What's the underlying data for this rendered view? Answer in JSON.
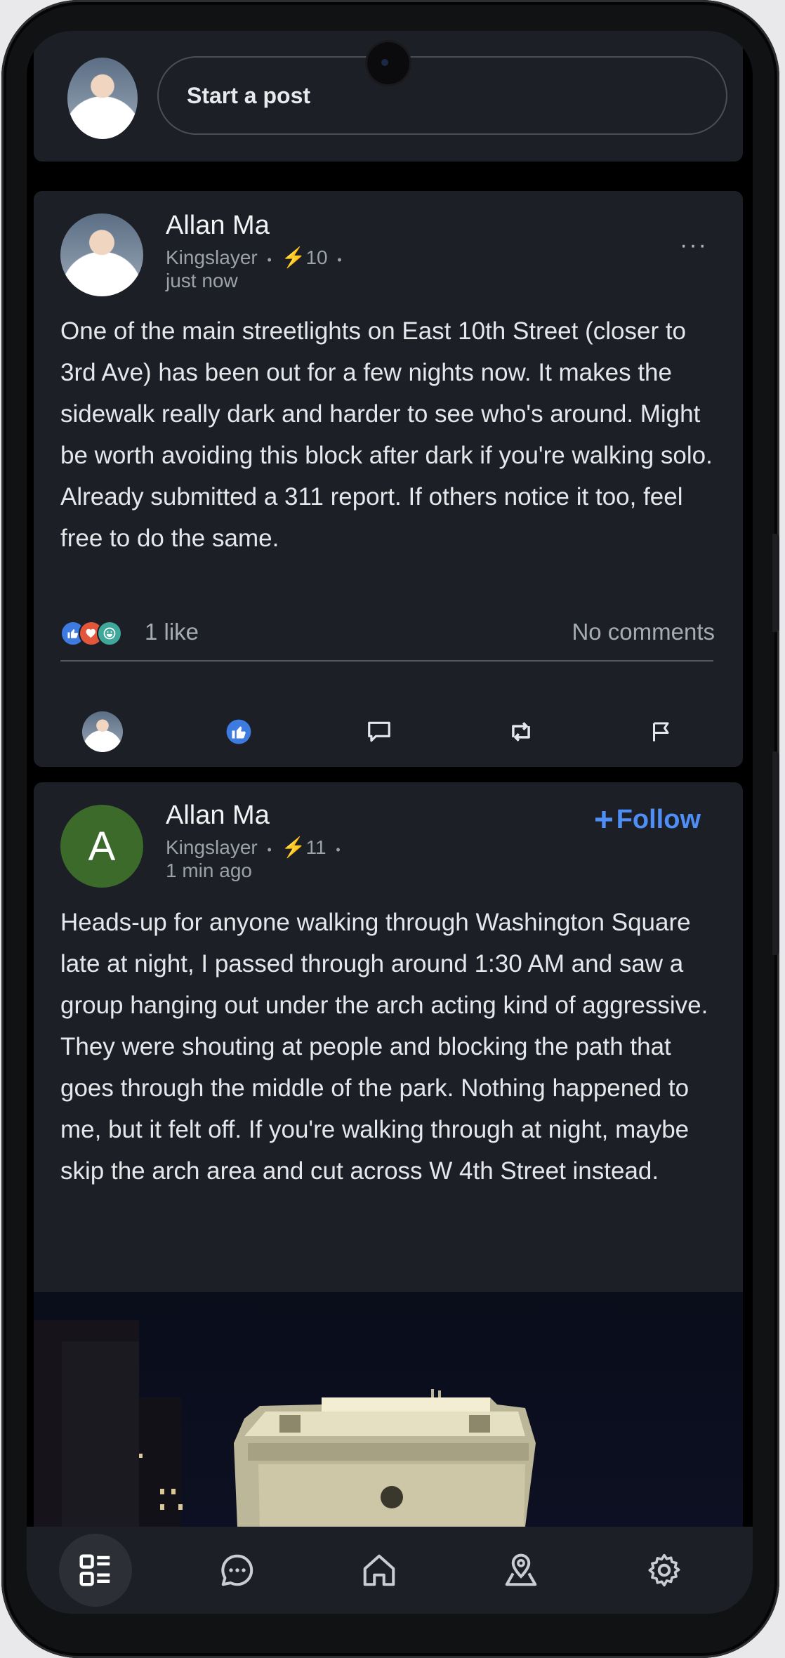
{
  "composer": {
    "placeholder": "Start a post"
  },
  "posts": [
    {
      "author": "Allan Ma",
      "title": "Kingslayer",
      "sep": "•",
      "karma": "⚡10",
      "time": "just now",
      "menu": "···",
      "text": "One of the main streetlights on East 10th Street (closer to 3rd Ave) has been out for a few nights now. It makes the sidewalk really dark and harder to see who's around. Might be worth avoiding this block after dark if you're walking solo. Already submitted a 311 report. If others notice it too, feel free to do the same.",
      "likes": "1 like",
      "comments": "No comments"
    },
    {
      "author": "Allan Ma",
      "avatar_letter": "A",
      "title": "Kingslayer",
      "sep": "•",
      "karma": "⚡11",
      "time": "1 min ago",
      "follow": "Follow",
      "text": "Heads-up for anyone walking through Washington Square late at night, I passed through around 1:30 AM and saw a group hanging out under the arch acting kind of aggressive. They were shouting at people and blocking the path that goes through the middle of the park. Nothing happened to me, but it felt off. If you're walking through at night, maybe skip the arch area and cut across W 4th Street instead."
    }
  ],
  "colors": {
    "card": "#1c1f25",
    "accent": "#4f8ef5",
    "avatar_green": "#3b6a2a"
  },
  "icons": {
    "reactions": [
      "thumbs-up-icon",
      "heart-icon",
      "laugh-icon"
    ],
    "actions": [
      "user-avatar-icon",
      "like-icon",
      "comment-icon",
      "repost-icon",
      "flag-icon"
    ],
    "nav": [
      "feed-icon",
      "chat-icon",
      "home-icon",
      "map-pin-icon",
      "settings-icon"
    ]
  }
}
